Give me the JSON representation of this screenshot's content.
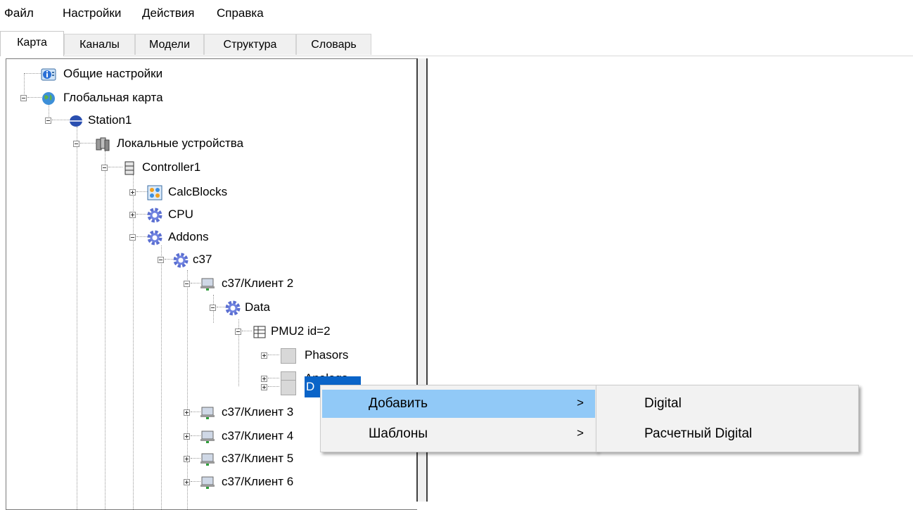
{
  "menubar": {
    "items": [
      "Файл",
      "Настройки",
      "Действия",
      "Справка"
    ]
  },
  "tabs": [
    {
      "label": "Карта",
      "active": true
    },
    {
      "label": "Каналы"
    },
    {
      "label": "Модели"
    },
    {
      "label": "Структура"
    },
    {
      "label": "Словарь"
    }
  ],
  "tree": {
    "general_settings": "Общие настройки",
    "global_map": "Глобальная карта",
    "station1": "Station1",
    "local_devices": "Локальные устройства",
    "controller1": "Controller1",
    "calcblocks": "CalcBlocks",
    "cpu": "CPU",
    "addons": "Addons",
    "c37": "c37",
    "client2": "c37/Клиент 2",
    "data": "Data",
    "pmu2": "PMU2 id=2",
    "phasors": "Phasors",
    "analogs": "Analogs",
    "digitals": "D",
    "client3": "c37/Клиент 3",
    "client4": "c37/Клиент 4",
    "client5": "c37/Клиент 5",
    "client6": "c37/Клиент 6"
  },
  "context_menu": {
    "add": "Добавить",
    "templates": "Шаблоны",
    "arrow": ">"
  },
  "submenu": {
    "digital": "Digital",
    "calc_digital": "Расчетный Digital"
  },
  "colors": {
    "selection": "#0a64c8",
    "menu_highlight": "#91c9f7",
    "menu_bg": "#f2f2f2"
  }
}
